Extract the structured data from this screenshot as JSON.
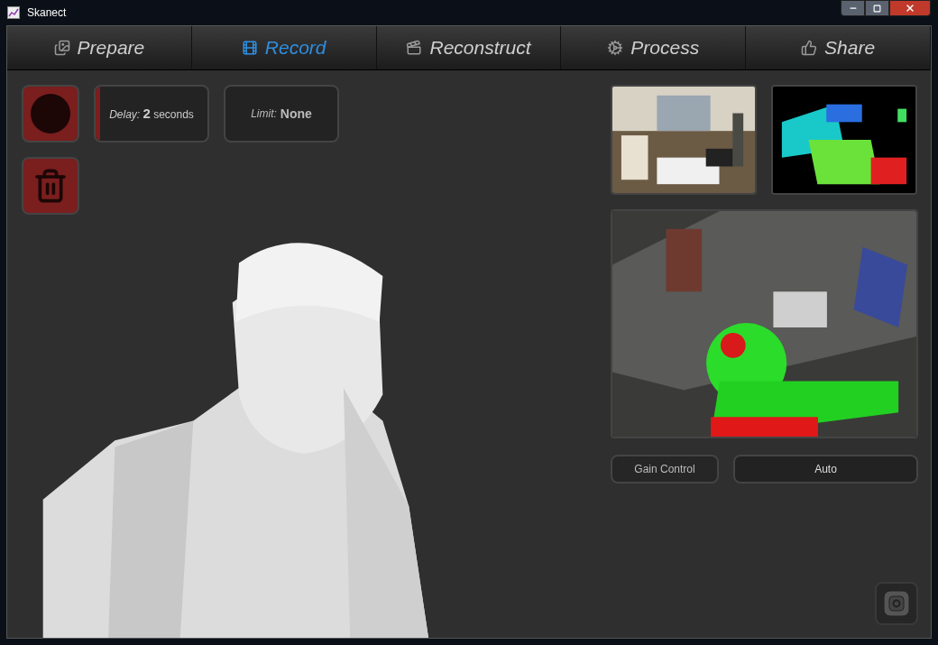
{
  "window": {
    "title": "Skanect"
  },
  "tabs": [
    {
      "label": "Prepare",
      "selected": false
    },
    {
      "label": "Record",
      "selected": true
    },
    {
      "label": "Reconstruct",
      "selected": false
    },
    {
      "label": "Process",
      "selected": false
    },
    {
      "label": "Share",
      "selected": false
    }
  ],
  "record_controls": {
    "delay": {
      "label": "Delay:",
      "value": "2",
      "unit": "seconds",
      "level": 0.04
    },
    "limit": {
      "label": "Limit:",
      "value": "None"
    }
  },
  "camera_views": [
    {
      "kind": "color"
    },
    {
      "kind": "depth"
    },
    {
      "kind": "overlay"
    }
  ],
  "gain_control": {
    "label": "Gain Control",
    "value": "Auto"
  }
}
